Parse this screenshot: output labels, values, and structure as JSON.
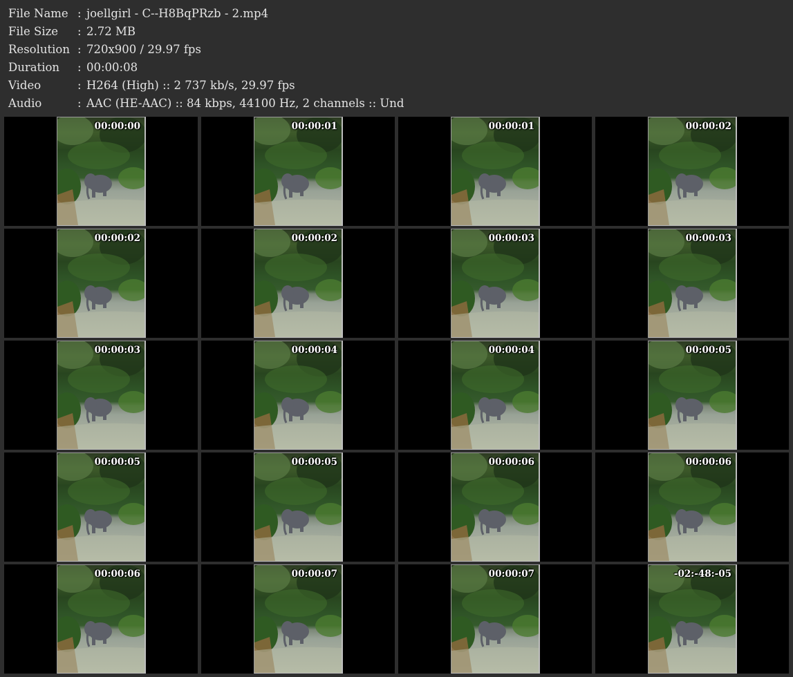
{
  "info": [
    {
      "label": "File Name",
      "value": "joellgirl - C--H8BqPRzb - 2.mp4"
    },
    {
      "label": "File Size",
      "value": "2.72 MB"
    },
    {
      "label": "Resolution",
      "value": "720x900 / 29.97 fps"
    },
    {
      "label": "Duration",
      "value": "00:00:08"
    },
    {
      "label": "Video",
      "value": "H264 (High) :: 2 737 kb/s, 29.97 fps"
    },
    {
      "label": "Audio",
      "value": "AAC (HE-AAC) :: 84 kbps, 44100 Hz, 2 channels :: Und"
    }
  ],
  "separator": ":",
  "thumbnails": [
    "00:00:00",
    "00:00:01",
    "00:00:01",
    "00:00:02",
    "00:00:02",
    "00:00:02",
    "00:00:03",
    "00:00:03",
    "00:00:03",
    "00:00:04",
    "00:00:04",
    "00:00:05",
    "00:00:05",
    "00:00:05",
    "00:00:06",
    "00:00:06",
    "00:00:06",
    "00:00:07",
    "00:00:07",
    "-02:-48:-05"
  ],
  "colors": {
    "background": "#2e2e2e",
    "cell": "#000000",
    "text": "#e4e4e4",
    "timestamp": "#ffffff"
  }
}
